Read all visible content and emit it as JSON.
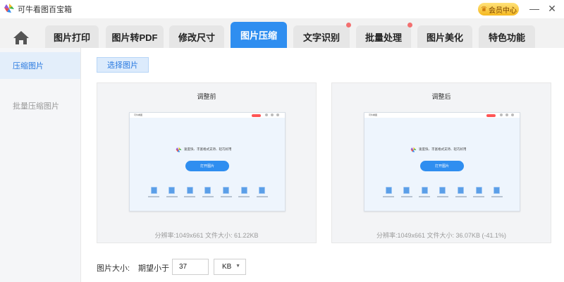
{
  "app": {
    "title": "可牛看图百宝箱",
    "vip_label": "会员中心"
  },
  "window_controls": {
    "minimize": "—",
    "close": "✕"
  },
  "tabs": [
    {
      "label": "图片打印",
      "active": false,
      "badge": false
    },
    {
      "label": "图片转PDF",
      "active": false,
      "badge": false
    },
    {
      "label": "修改尺寸",
      "active": false,
      "badge": false
    },
    {
      "label": "图片压缩",
      "active": true,
      "badge": false
    },
    {
      "label": "文字识别",
      "active": false,
      "badge": true
    },
    {
      "label": "批量处理",
      "active": false,
      "badge": true
    },
    {
      "label": "图片美化",
      "active": false,
      "badge": false
    },
    {
      "label": "特色功能",
      "active": false,
      "badge": false
    }
  ],
  "sidebar": {
    "items": [
      {
        "label": "压缩图片",
        "active": true
      },
      {
        "label": "批量压缩图片",
        "active": false
      }
    ]
  },
  "main": {
    "select_button": "选择图片",
    "before": {
      "title": "调整前",
      "info": "分辨率:1049x661 文件大小: 61.22KB"
    },
    "after": {
      "title": "调整后",
      "info": "分辨率:1049x661 文件大小: 36.07KB (-41.1%)"
    },
    "preview": {
      "app_name": "可牛看图",
      "slogan": "速度快、丰富格式支持、轻巧好用",
      "open_button": "打开图片"
    },
    "size_label": "图片大小:",
    "expect_label": "期望小于",
    "size_value": "37",
    "unit": "KB"
  },
  "colors": {
    "accent": "#2f8ef0",
    "badge": "#f37070",
    "sidebar_active_bg": "#e3eefa",
    "panel_bg": "#f3f4f6"
  }
}
